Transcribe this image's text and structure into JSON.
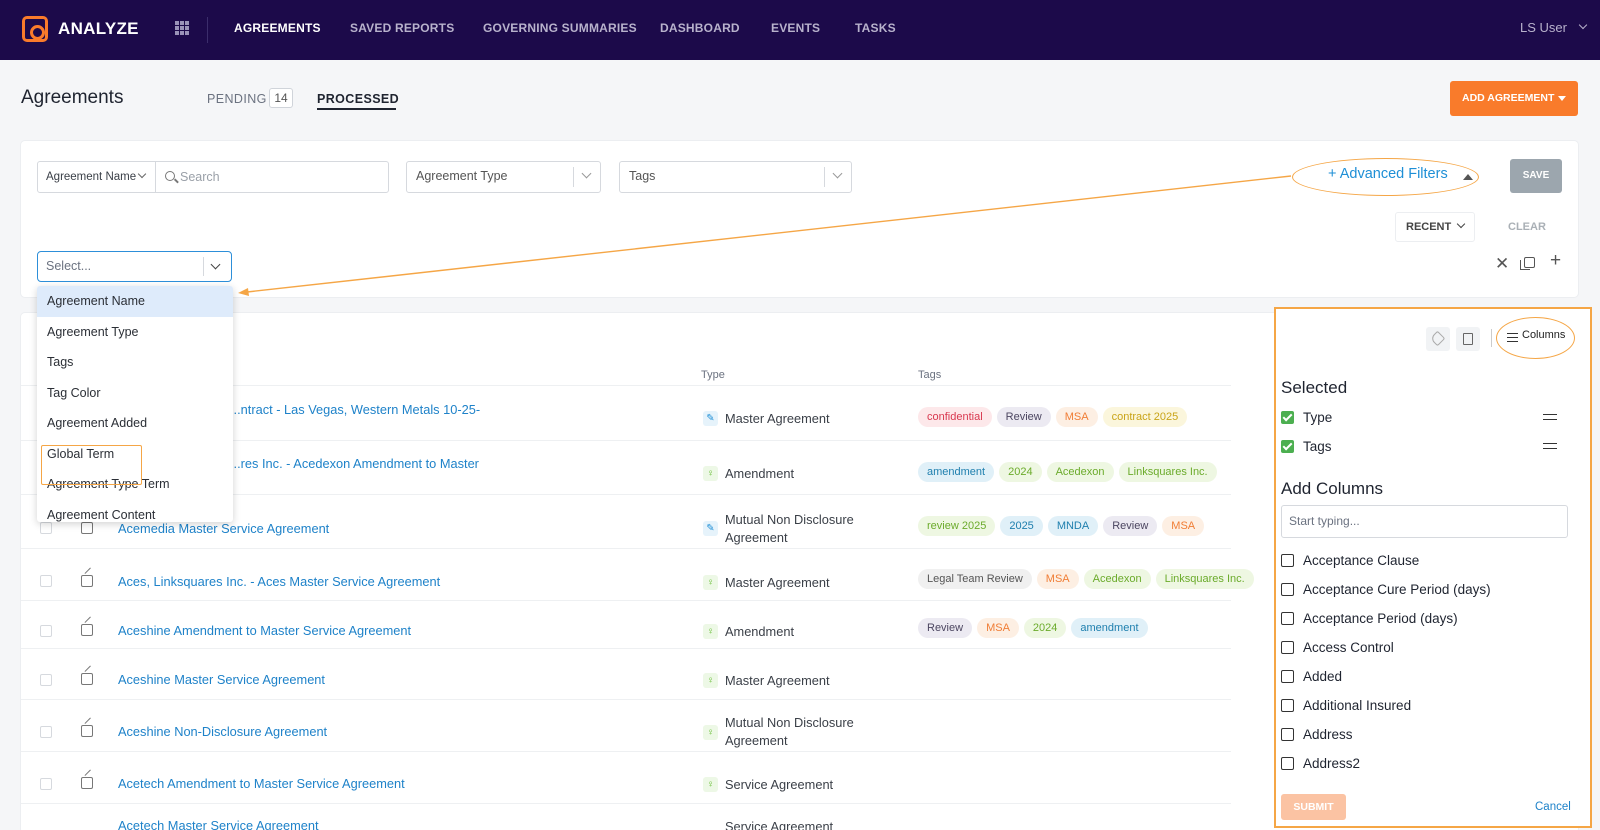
{
  "app": {
    "name": "ANALYZE",
    "user": "LS User"
  },
  "nav": [
    {
      "label": "AGREEMENTS",
      "active": true
    },
    {
      "label": "SAVED REPORTS"
    },
    {
      "label": "GOVERNING SUMMARIES"
    },
    {
      "label": "DASHBOARD"
    },
    {
      "label": "EVENTS"
    },
    {
      "label": "TASKS"
    }
  ],
  "header": {
    "title": "Agreements",
    "tab_pending": "PENDING",
    "pending_count": "14",
    "tab_processed": "PROCESSED",
    "add_button": "ADD AGREEMENT"
  },
  "filters": {
    "agreement_name": "Agreement Name",
    "search_placeholder": "Search",
    "agreement_type": "Agreement Type",
    "tags": "Tags",
    "advanced": "Advanced Filters",
    "save": "SAVE",
    "recent": "RECENT",
    "clear": "CLEAR",
    "select_placeholder": "Select..."
  },
  "dropdown": {
    "items": [
      "Agreement Name",
      "Agreement Type",
      "Tags",
      "Tag Color",
      "Agreement Added",
      "Global Term",
      "Agreement Type Term",
      "Agreement Content"
    ]
  },
  "table": {
    "col_type": "Type",
    "col_tags": "Tags",
    "rows": [
      {
        "name": "...ntract - Las Vegas, Western Metals 10-25-",
        "type": "Master Agreement",
        "icon": "pencil-icon",
        "tags": [
          "confidential",
          "Review",
          "MSA",
          "contract 2025"
        ]
      },
      {
        "name": "...res Inc. - Acedexon Amendment to Master",
        "type": "Amendment",
        "icon": "bulb-icon",
        "tags": [
          "amendment",
          "2024",
          "Acedexon",
          "Linksquares Inc."
        ]
      },
      {
        "name": "Acemedia Master Service Agreement",
        "type": "Mutual Non Disclosure Agreement",
        "icon": "pencil-icon",
        "tags": [
          "review 2025",
          "2025",
          "MNDA",
          "Review",
          "MSA"
        ]
      },
      {
        "name": "Aces, Linksquares Inc. - Aces Master Service Agreement",
        "type": "Master Agreement",
        "icon": "bulb-icon",
        "tags": [
          "Legal Team Review",
          "MSA",
          "Acedexon",
          "Linksquares Inc."
        ]
      },
      {
        "name": "Aceshine Amendment to Master Service Agreement",
        "type": "Amendment",
        "icon": "bulb-icon",
        "tags": [
          "Review",
          "MSA",
          "2024",
          "amendment"
        ]
      },
      {
        "name": "Aceshine Master Service Agreement",
        "type": "Master Agreement",
        "icon": "bulb-icon",
        "tags": []
      },
      {
        "name": "Aceshine Non-Disclosure Agreement",
        "type": "Mutual Non Disclosure Agreement",
        "icon": "bulb-icon",
        "tags": []
      },
      {
        "name": "Acetech Amendment to Master Service Agreement",
        "type": "Service Agreement",
        "icon": "bulb-icon",
        "tags": []
      },
      {
        "name": "Acetech Master Service Agreement",
        "type": "Service Agreement",
        "icon": "bulb-icon",
        "tags": []
      }
    ]
  },
  "columns_panel": {
    "button": "Columns",
    "selected_title": "Selected",
    "selected": [
      "Type",
      "Tags"
    ],
    "add_title": "Add Columns",
    "input_placeholder": "Start typing...",
    "options": [
      "Acceptance Clause",
      "Acceptance Cure Period (days)",
      "Acceptance Period (days)",
      "Access Control",
      "Added",
      "Additional Insured",
      "Address",
      "Address2"
    ],
    "submit": "SUBMIT",
    "cancel": "Cancel"
  },
  "colors": {
    "brand": "#1c0a4a",
    "accent": "#f97b2b",
    "link": "#1e82c9",
    "highlight": "#f5a646"
  }
}
